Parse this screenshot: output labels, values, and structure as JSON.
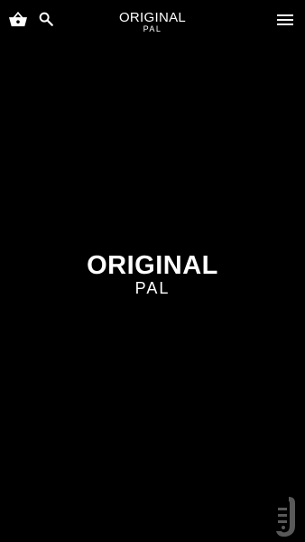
{
  "header": {
    "title": "ORIGINAL",
    "subtitle": "PAL",
    "icons": {
      "cart": "shopping-basket-icon",
      "search": "search-icon",
      "menu": "hamburger-menu-icon"
    }
  },
  "splash": {
    "title": "ORIGINAL",
    "subtitle": "PAL"
  },
  "colors": {
    "background": "#000000",
    "foreground": "#ffffff"
  }
}
